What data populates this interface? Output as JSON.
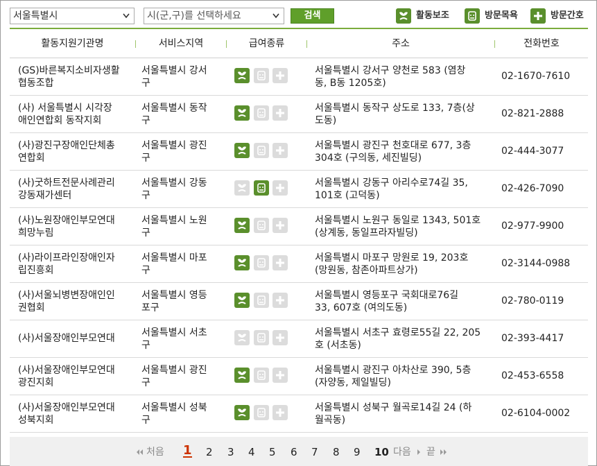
{
  "toolbar": {
    "city_select": "서울특별시",
    "district_select": "시(군,구)를 선택하세요",
    "search_label": "검색",
    "legend": [
      {
        "label": "활동보조",
        "icon": "activity-support-icon"
      },
      {
        "label": "방문목욕",
        "icon": "bath-icon"
      },
      {
        "label": "방문간호",
        "icon": "nursing-icon"
      }
    ]
  },
  "table": {
    "headers": [
      "활동지원기관명",
      "서비스지역",
      "급여종류",
      "주소",
      "전화번호"
    ],
    "rows": [
      {
        "org1": "(GS)바른복지소비자생활",
        "org2": "협동조합",
        "area1": "서울특별시 강서",
        "area2": "구",
        "svc": [
          true,
          false,
          false
        ],
        "addr1": "서울특별시 강서구 양천로 583 (염창",
        "addr2": "동, B동 1205호)",
        "tel": "02-1670-7610"
      },
      {
        "org1": "(사) 서울특별시 시각장",
        "org2": "애인연합회 동작지회",
        "area1": "서울특별시 동작",
        "area2": "구",
        "svc": [
          true,
          false,
          false
        ],
        "addr1": "서울특별시 동작구 상도로 133, 7층(상",
        "addr2": "도동)",
        "tel": "02-821-2888"
      },
      {
        "org1": "(사)광진구장애인단체총",
        "org2": "연합회",
        "area1": "서울특별시 광진",
        "area2": "구",
        "svc": [
          true,
          false,
          false
        ],
        "addr1": "서울특별시 광진구 천호대로 677, 3층",
        "addr2": "304호 (구의동, 세진빌딩)",
        "tel": "02-444-3077"
      },
      {
        "org1": "(사)굿하트전문사례관리",
        "org2": "강동재가센터",
        "area1": "서울특별시 강동",
        "area2": "구",
        "svc": [
          false,
          true,
          false
        ],
        "addr1": "서울특별시 강동구 아리수로74길 35,",
        "addr2": "101호 (고덕동)",
        "tel": "02-426-7090"
      },
      {
        "org1": "(사)노원장애인부모연대",
        "org2": "희망누림",
        "area1": "서울특별시 노원",
        "area2": "구",
        "svc": [
          true,
          false,
          false
        ],
        "addr1": "서울특별시 노원구 동일로 1343, 501호",
        "addr2": "(상계동, 동일프라자빌딩)",
        "tel": "02-977-9900"
      },
      {
        "org1": "(사)라이프라인장애인자",
        "org2": "립진흥회",
        "area1": "서울특별시 마포",
        "area2": "구",
        "svc": [
          true,
          false,
          false
        ],
        "addr1": "서울특별시 마포구 망원로 19, 203호",
        "addr2": "(망원동, 참존아파트상가)",
        "tel": "02-3144-0988"
      },
      {
        "org1": "(사)서울뇌병변장애인인",
        "org2": "권협회",
        "area1": "서울특별시 영등",
        "area2": "포구",
        "svc": [
          true,
          false,
          false
        ],
        "addr1": "서울특별시 영등포구 국회대로76길",
        "addr2": "33, 607호 (여의도동)",
        "tel": "02-780-0119"
      },
      {
        "org1": "(사)서울장애인부모연대",
        "org2": "",
        "area1": "서울특별시 서초",
        "area2": "구",
        "svc": [
          false,
          false,
          false
        ],
        "addr1": "서울특별시 서초구 효령로55길 22, 205",
        "addr2": "호 (서초동)",
        "tel": "02-393-4417"
      },
      {
        "org1": "(사)서울장애인부모연대",
        "org2": "광진지회",
        "area1": "서울특별시 광진",
        "area2": "구",
        "svc": [
          true,
          false,
          false
        ],
        "addr1": "서울특별시 광진구 아차산로 390, 5층",
        "addr2": "(자양동, 제일빌딩)",
        "tel": "02-453-6558"
      },
      {
        "org1": "(사)서울장애인부모연대",
        "org2": "성북지회",
        "area1": "서울특별시 성북",
        "area2": "구",
        "svc": [
          true,
          false,
          false
        ],
        "addr1": "서울특별시 성북구 월곡로14길 24 (하",
        "addr2": "월곡동)",
        "tel": "02-6104-0002"
      }
    ]
  },
  "pager": {
    "first": "처음",
    "pages": [
      "1",
      "2",
      "3",
      "4",
      "5",
      "6",
      "7",
      "8",
      "9",
      "10"
    ],
    "current": "1",
    "next": "다음",
    "last": "끝"
  },
  "colors": {
    "accent": "#5a8f2c",
    "disabled": "#dcdcdc",
    "current_page": "#cc3300"
  }
}
